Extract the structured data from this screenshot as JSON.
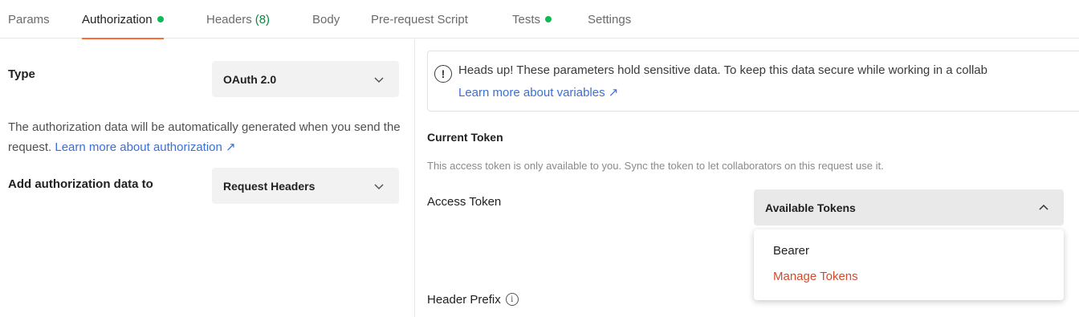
{
  "colors": {
    "accent": "#ff6c37",
    "green": "#0cbb52",
    "link": "#3a6fd8",
    "manage": "#d14b2f"
  },
  "tabs": [
    {
      "label": "Params",
      "dot": false
    },
    {
      "label": "Authorization",
      "dot": true
    },
    {
      "label": "Headers",
      "count": "(8)"
    },
    {
      "label": "Body"
    },
    {
      "label": "Pre-request Script"
    },
    {
      "label": "Tests",
      "dot": true
    },
    {
      "label": "Settings"
    }
  ],
  "left": {
    "type_label": "Type",
    "type_value": "OAuth 2.0",
    "description": "The authorization data will be automatically generated when you send the request.",
    "learn_link": "Learn more about authorization ↗",
    "add_label": "Add authorization data to",
    "add_value": "Request Headers"
  },
  "right": {
    "alert_icon": "!",
    "alert_text": "Heads up! These parameters hold sensitive data. To keep this data secure while working in a collab",
    "alert_link": "Learn more about variables ↗",
    "current_token_title": "Current Token",
    "current_token_desc": "This access token is only available to you. Sync the token to let collaborators on this request use it.",
    "access_token_label": "Access Token",
    "available_tokens": "Available Tokens",
    "menu": {
      "bearer": "Bearer",
      "manage": "Manage Tokens"
    },
    "header_prefix_label": "Header Prefix",
    "info_icon": "i"
  }
}
